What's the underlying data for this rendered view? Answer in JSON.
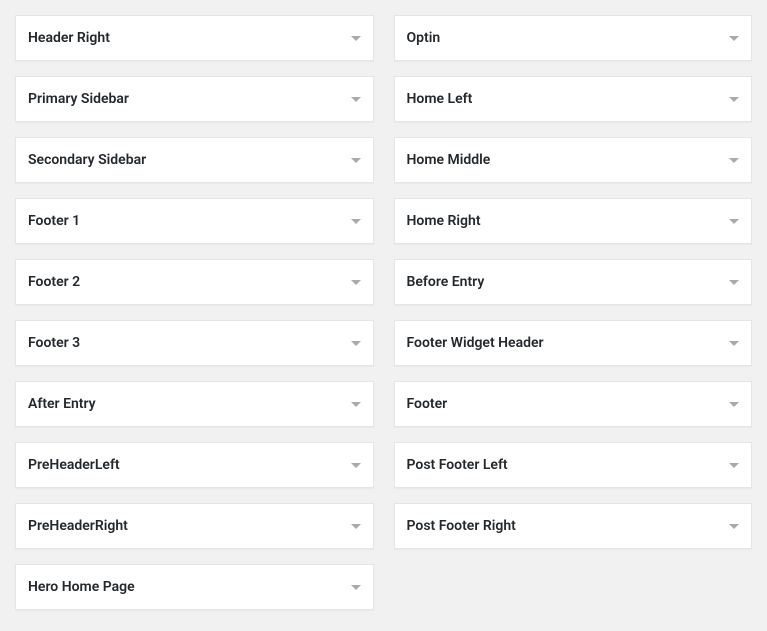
{
  "columns": {
    "left": [
      {
        "id": "header-right",
        "label": "Header Right"
      },
      {
        "id": "primary-sidebar",
        "label": "Primary Sidebar"
      },
      {
        "id": "secondary-sidebar",
        "label": "Secondary Sidebar"
      },
      {
        "id": "footer-1",
        "label": "Footer 1"
      },
      {
        "id": "footer-2",
        "label": "Footer 2"
      },
      {
        "id": "footer-3",
        "label": "Footer 3"
      },
      {
        "id": "after-entry",
        "label": "After Entry"
      },
      {
        "id": "preheader-left",
        "label": "PreHeaderLeft"
      },
      {
        "id": "preheader-right",
        "label": "PreHeaderRight"
      },
      {
        "id": "hero-home-page",
        "label": "Hero Home Page"
      }
    ],
    "right": [
      {
        "id": "optin",
        "label": "Optin"
      },
      {
        "id": "home-left",
        "label": "Home Left"
      },
      {
        "id": "home-middle",
        "label": "Home Middle"
      },
      {
        "id": "home-right",
        "label": "Home Right"
      },
      {
        "id": "before-entry",
        "label": "Before Entry"
      },
      {
        "id": "footer-widget-header",
        "label": "Footer Widget Header"
      },
      {
        "id": "footer",
        "label": "Footer"
      },
      {
        "id": "post-footer-left",
        "label": "Post Footer Left"
      },
      {
        "id": "post-footer-right",
        "label": "Post Footer Right"
      }
    ]
  }
}
